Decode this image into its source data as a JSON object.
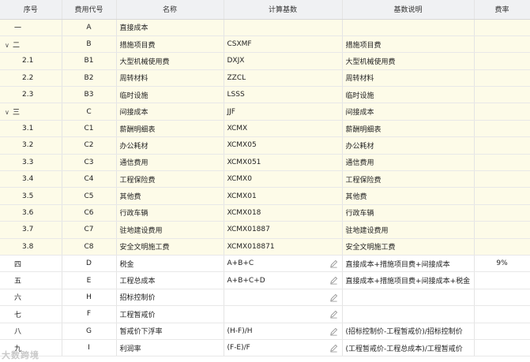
{
  "headers": [
    "序号",
    "费用代号",
    "名称",
    "计算基数",
    "基数说明",
    "费率"
  ],
  "rows": [
    {
      "seq": "一",
      "code": "A",
      "name": "直接成本",
      "base": "",
      "desc": "",
      "rate": "",
      "hl": true,
      "caret": false,
      "sub": false,
      "edit": false
    },
    {
      "seq": "二",
      "code": "B",
      "name": "措施项目费",
      "base": "CSXMF",
      "desc": "措施项目费",
      "rate": "",
      "hl": true,
      "caret": true,
      "sub": false,
      "edit": false
    },
    {
      "seq": "2.1",
      "code": "B1",
      "name": "大型机械使用费",
      "base": "DXJX",
      "desc": "大型机械使用费",
      "rate": "",
      "hl": true,
      "caret": false,
      "sub": true,
      "edit": false
    },
    {
      "seq": "2.2",
      "code": "B2",
      "name": "周转材料",
      "base": "ZZCL",
      "desc": "周转材料",
      "rate": "",
      "hl": true,
      "caret": false,
      "sub": true,
      "edit": false
    },
    {
      "seq": "2.3",
      "code": "B3",
      "name": "临时设施",
      "base": "LSSS",
      "desc": "临时设施",
      "rate": "",
      "hl": true,
      "caret": false,
      "sub": true,
      "edit": false
    },
    {
      "seq": "三",
      "code": "C",
      "name": "间接成本",
      "base": "JJF",
      "desc": "间接成本",
      "rate": "",
      "hl": true,
      "caret": true,
      "sub": false,
      "edit": false
    },
    {
      "seq": "3.1",
      "code": "C1",
      "name": "薪酬明细表",
      "base": "XCMX",
      "desc": "薪酬明细表",
      "rate": "",
      "hl": true,
      "caret": false,
      "sub": true,
      "edit": false
    },
    {
      "seq": "3.2",
      "code": "C2",
      "name": "办公耗材",
      "base": "XCMX05",
      "desc": "办公耗材",
      "rate": "",
      "hl": true,
      "caret": false,
      "sub": true,
      "edit": false
    },
    {
      "seq": "3.3",
      "code": "C3",
      "name": "通信费用",
      "base": "XCMX051",
      "desc": "通信费用",
      "rate": "",
      "hl": true,
      "caret": false,
      "sub": true,
      "edit": false
    },
    {
      "seq": "3.4",
      "code": "C4",
      "name": "工程保险费",
      "base": "XCMX0",
      "desc": "工程保险费",
      "rate": "",
      "hl": true,
      "caret": false,
      "sub": true,
      "edit": false
    },
    {
      "seq": "3.5",
      "code": "C5",
      "name": "其他费",
      "base": "XCMX01",
      "desc": "其他费",
      "rate": "",
      "hl": true,
      "caret": false,
      "sub": true,
      "edit": false
    },
    {
      "seq": "3.6",
      "code": "C6",
      "name": "行政车辆",
      "base": "XCMX018",
      "desc": "行政车辆",
      "rate": "",
      "hl": true,
      "caret": false,
      "sub": true,
      "edit": false
    },
    {
      "seq": "3.7",
      "code": "C7",
      "name": "驻地建设费用",
      "base": "XCMX01887",
      "desc": "驻地建设费用",
      "rate": "",
      "hl": true,
      "caret": false,
      "sub": true,
      "edit": false
    },
    {
      "seq": "3.8",
      "code": "C8",
      "name": "安全文明施工费",
      "base": "XCMX018871",
      "desc": "安全文明施工费",
      "rate": "",
      "hl": true,
      "caret": false,
      "sub": true,
      "edit": false
    },
    {
      "seq": "四",
      "code": "D",
      "name": "税金",
      "base": "A+B+C",
      "desc": "直接成本+措施项目费+间接成本",
      "rate": "9%",
      "hl": false,
      "caret": false,
      "sub": false,
      "edit": true
    },
    {
      "seq": "五",
      "code": "E",
      "name": "工程总成本",
      "base": "A+B+C+D",
      "desc": "直接成本+措施项目费+间接成本+税金",
      "rate": "",
      "hl": false,
      "caret": false,
      "sub": false,
      "edit": true
    },
    {
      "seq": "六",
      "code": "H",
      "name": "招标控制价",
      "base": "",
      "desc": "",
      "rate": "",
      "hl": false,
      "caret": false,
      "sub": false,
      "edit": true
    },
    {
      "seq": "七",
      "code": "F",
      "name": "工程暂戒价",
      "base": "",
      "desc": "",
      "rate": "",
      "hl": false,
      "caret": false,
      "sub": false,
      "edit": true
    },
    {
      "seq": "八",
      "code": "G",
      "name": "暂戒价下浮率",
      "base": "(H-F)/H",
      "desc": "(招标控制价-工程暂戒价)/招标控制价",
      "rate": "",
      "hl": false,
      "caret": false,
      "sub": false,
      "edit": true
    },
    {
      "seq": "九",
      "code": "I",
      "name": "利润率",
      "base": "(F-E)/F",
      "desc": "(工程暂戒价-工程总成本)/工程暂戒价",
      "rate": "",
      "hl": false,
      "caret": false,
      "sub": false,
      "edit": true
    }
  ],
  "watermark": "大数跨境",
  "icons": {
    "edit": "pencil-icon",
    "caret": "chevron-down-icon"
  }
}
